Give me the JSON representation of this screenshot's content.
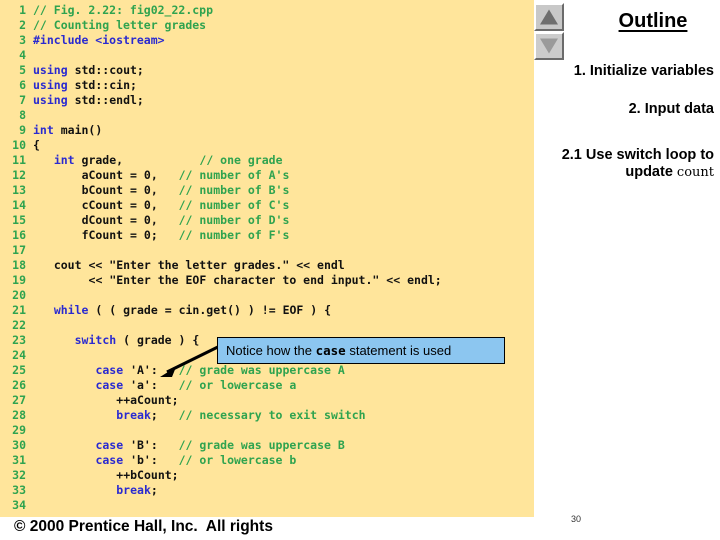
{
  "slide": {
    "code_panel": {
      "background_color": "#ffe59b",
      "lines": [
        {
          "num": "1",
          "text": "// Fig. 2.22: fig02_22.cpp",
          "kind": "comment"
        },
        {
          "num": "2",
          "text": "// Counting letter grades",
          "kind": "comment"
        },
        {
          "num": "3",
          "text": "#include <iostream>",
          "kind": "preprocessor"
        },
        {
          "num": "4",
          "text": "",
          "kind": "blank"
        },
        {
          "num": "5",
          "text": "using std::cout;",
          "kind": "mixed"
        },
        {
          "num": "6",
          "text": "using std::cin;",
          "kind": "mixed"
        },
        {
          "num": "7",
          "text": "using std::endl;",
          "kind": "mixed"
        },
        {
          "num": "8",
          "text": "",
          "kind": "blank"
        },
        {
          "num": "9",
          "text": "int main()",
          "kind": "mixed"
        },
        {
          "num": "10",
          "text": "{",
          "kind": "plain"
        },
        {
          "num": "11",
          "text": "   int grade,           // one grade",
          "kind": "mixed"
        },
        {
          "num": "12",
          "text": "       aCount = 0,   // number of A's",
          "kind": "mixed"
        },
        {
          "num": "13",
          "text": "       bCount = 0,   // number of B's",
          "kind": "mixed"
        },
        {
          "num": "14",
          "text": "       cCount = 0,   // number of C's",
          "kind": "mixed"
        },
        {
          "num": "15",
          "text": "       dCount = 0,   // number of D's",
          "kind": "mixed"
        },
        {
          "num": "16",
          "text": "       fCount = 0;   // number of F's",
          "kind": "mixed"
        },
        {
          "num": "17",
          "text": "",
          "kind": "blank"
        },
        {
          "num": "18",
          "text": "   cout << \"Enter the letter grades.\" << endl",
          "kind": "mixed"
        },
        {
          "num": "19",
          "text": "        << \"Enter the EOF character to end input.\" << endl;",
          "kind": "mixed"
        },
        {
          "num": "20",
          "text": "",
          "kind": "blank"
        },
        {
          "num": "21",
          "text": "   while ( ( grade = cin.get() ) != EOF ) {",
          "kind": "mixed"
        },
        {
          "num": "22",
          "text": "",
          "kind": "blank"
        },
        {
          "num": "23",
          "text": "      switch ( grade ) {",
          "kind": "mixed"
        },
        {
          "num": "24",
          "text": "",
          "kind": "blank"
        },
        {
          "num": "25",
          "text": "         case 'A':   // grade was uppercase A",
          "kind": "mixed"
        },
        {
          "num": "26",
          "text": "         case 'a':   // or lowercase a",
          "kind": "mixed"
        },
        {
          "num": "27",
          "text": "            ++aCount;",
          "kind": "plain"
        },
        {
          "num": "28",
          "text": "            break;   // necessary to exit switch",
          "kind": "mixed"
        },
        {
          "num": "29",
          "text": "",
          "kind": "blank"
        },
        {
          "num": "30",
          "text": "         case 'B':   // grade was uppercase B",
          "kind": "mixed"
        },
        {
          "num": "31",
          "text": "         case 'b':   // or lowercase b",
          "kind": "mixed"
        },
        {
          "num": "32",
          "text": "            ++bCount;",
          "kind": "plain"
        },
        {
          "num": "33",
          "text": "            break;",
          "kind": "plain"
        },
        {
          "num": "34",
          "text": "",
          "kind": "blank"
        }
      ]
    },
    "callout": {
      "text_before": "Notice how the ",
      "mono_word": "case",
      "text_after": " statement is used",
      "background_color": "#8cc6f0",
      "border_color": "#000000"
    },
    "outline": {
      "title": "Outline",
      "scroll_up_label": "▲",
      "scroll_down_label": "▼",
      "items": [
        {
          "number": "1.",
          "label": "Initialize variables"
        },
        {
          "number": "2.",
          "label": "Input data"
        },
        {
          "number": "2.1",
          "label_line1": "Use switch loop to",
          "label_line2": "update ",
          "label_mono": "count"
        }
      ]
    },
    "footer": {
      "copyright": "© 2000 Prentice Hall, Inc.  All rights",
      "page_number": "30"
    }
  }
}
